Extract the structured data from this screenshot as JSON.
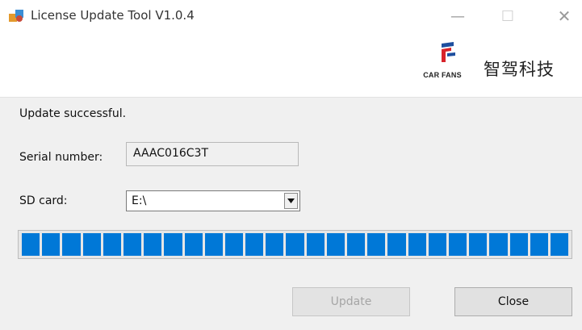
{
  "window": {
    "title": "License Update Tool V1.0.4",
    "icon": "app-icon",
    "minimize_glyph": "—",
    "maximize_glyph": "☐",
    "close_glyph": "✕"
  },
  "brand": {
    "logo_text": "CAR FANS",
    "chinese_name": "智驾科技",
    "accent_red": "#d8232a",
    "accent_blue": "#1d4e9e"
  },
  "form": {
    "status_text": "Update successful.",
    "serial_label": "Serial number:",
    "serial_value": "AAAC016C3T",
    "sd_label": "SD card:",
    "sd_value": "E:\\"
  },
  "progress": {
    "value_percent": 100,
    "segments_filled": 27,
    "color": "#0078d7"
  },
  "buttons": {
    "update_label": "Update",
    "update_enabled": false,
    "close_label": "Close"
  }
}
